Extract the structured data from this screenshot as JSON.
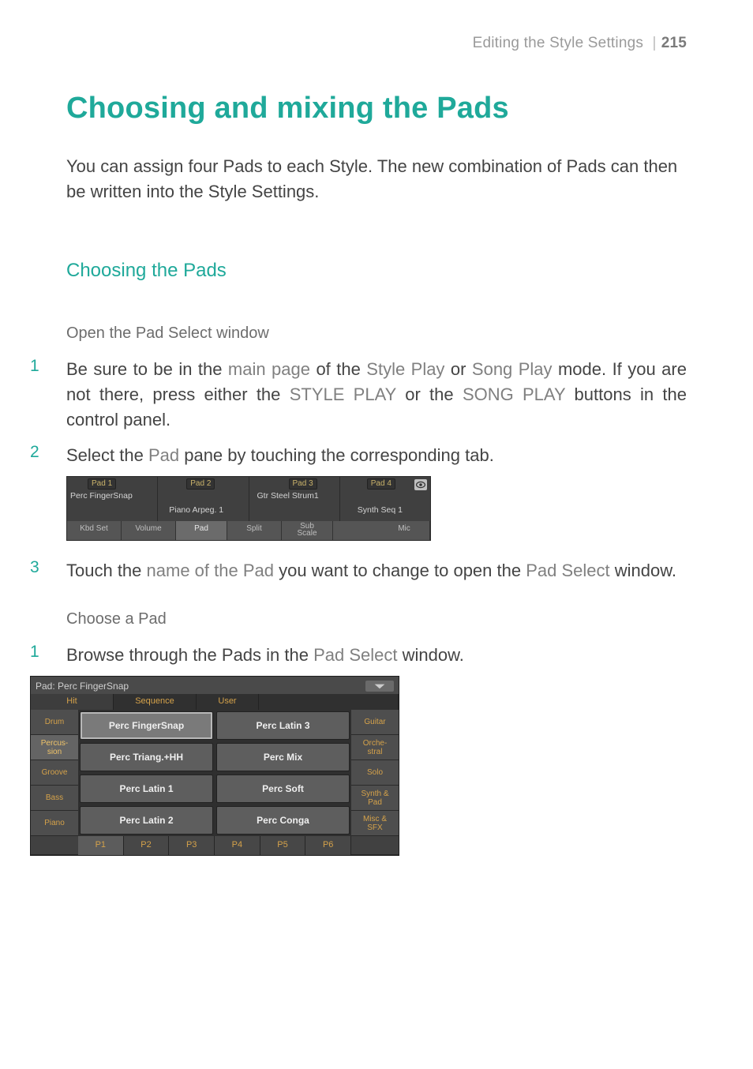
{
  "runner": {
    "section": "Editing the Style Settings",
    "page": "215"
  },
  "title": "Choosing and mixing the Pads",
  "intro": "You can assign four Pads to each Style. The new combination of Pads can then be written into the Style Settings.",
  "section_heading": "Choosing the Pads",
  "sub1": "Open the Pad Select window",
  "steps1": {
    "s1_num": "1",
    "s1": {
      "p1": "Be sure to be in the ",
      "p2": "main page",
      "p3": " of the ",
      "p4": "Style Play",
      "p5": " or ",
      "p6": "Song Play",
      "p7": " mode. If you are not there, press either the ",
      "p8": "STYLE PLAY",
      "p9": " or the ",
      "p10": "SONG PLAY",
      "p11": " buttons in the control panel."
    },
    "s2_num": "2",
    "s2": {
      "p1": "Select the ",
      "p2": "Pad",
      "p3": " pane by touching the corresponding tab."
    },
    "s3_num": "3",
    "s3": {
      "p1": "Touch the ",
      "p2": "name of the Pad",
      "p3": " you want to change to open the ",
      "p4": "Pad Select",
      "p5": " window."
    }
  },
  "pad_pane": {
    "pads": [
      {
        "label": "Pad 1",
        "value": "Perc FingerSnap"
      },
      {
        "label": "Pad 2",
        "value": "Piano Arpeg. 1"
      },
      {
        "label": "Pad 3",
        "value": "Gtr Steel Strum1"
      },
      {
        "label": "Pad 4",
        "value": "Synth Seq 1"
      }
    ],
    "tabs": {
      "kbd": "Kbd Set",
      "vol": "Volume",
      "pad": "Pad",
      "split": "Split",
      "sub": "Sub\nScale",
      "mic": "Mic"
    }
  },
  "sub2": "Choose a Pad",
  "steps2": {
    "s1_num": "1",
    "s1": {
      "p1": "Browse through the Pads in the ",
      "p2": "Pad Select",
      "p3": " window."
    }
  },
  "pad_select": {
    "title": "Pad: Perc FingerSnap",
    "top_tabs": {
      "hit": "Hit",
      "seq": "Sequence",
      "user": "User"
    },
    "left_cats": [
      "Drum",
      "Percus-\nsion",
      "Groove",
      "Bass",
      "Piano"
    ],
    "right_cats": [
      "Guitar",
      "Orche-\nstral",
      "Solo",
      "Synth &\nPad",
      "Misc &\nSFX"
    ],
    "grid": [
      "Perc FingerSnap",
      "Perc Latin 3",
      "Perc Triang.+HH",
      "Perc Mix",
      "Perc Latin 1",
      "Perc Soft",
      "Perc Latin 2",
      "Perc Conga"
    ],
    "pages": [
      "P1",
      "P2",
      "P3",
      "P4",
      "P5",
      "P6"
    ]
  }
}
